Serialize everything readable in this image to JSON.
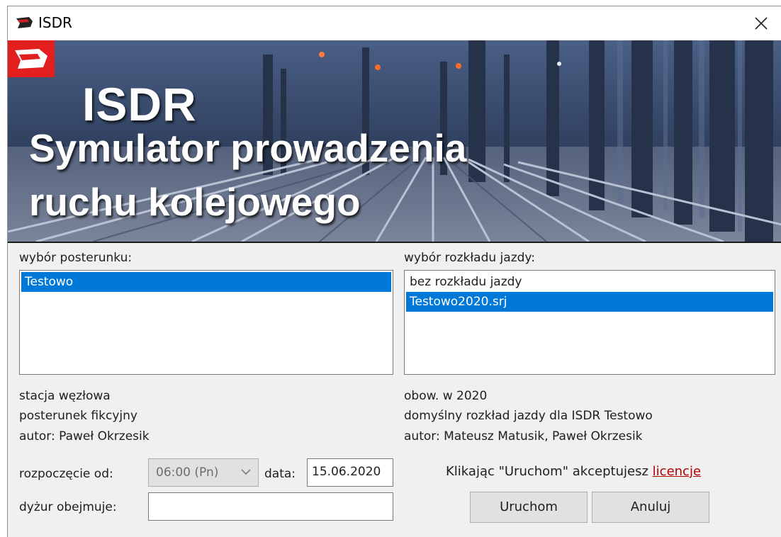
{
  "window": {
    "title": "ISDR"
  },
  "banner": {
    "title": "ISDR",
    "subtitle_line1": "Symulator prowadzenia",
    "subtitle_line2": "ruchu kolejowego"
  },
  "posterunek": {
    "label": "wybór posterunku:",
    "items": [
      "Testowo"
    ],
    "selected_index": 0,
    "info": [
      "stacja węzłowa",
      "posterunek fikcyjny",
      "autor: Paweł Okrzesik"
    ]
  },
  "rozklad": {
    "label": "wybór rozkładu jazdy:",
    "items": [
      "bez rozkładu jazdy",
      "Testowo2020.srj"
    ],
    "selected_index": 1,
    "info": [
      "obow. w 2020",
      "domyślny rozkład jazdy dla ISDR Testowo",
      "autor: Mateusz Matusik, Paweł Okrzesik"
    ]
  },
  "start": {
    "label": "rozpoczęcie od:",
    "value": "06:00 (Pn)",
    "date_label": "data:",
    "date_value": "15.06.2020"
  },
  "duty": {
    "label": "dyżur obejmuje:",
    "value": ""
  },
  "license": {
    "text": "Klikając \"Uruchom\" akceptujesz",
    "link": "licencje"
  },
  "buttons": {
    "run": "Uruchom",
    "cancel": "Anuluj"
  },
  "colors": {
    "selection": "#0078d7",
    "link": "#b30000",
    "logo_red": "#e31e1e"
  },
  "icons": {
    "app": "train-icon",
    "close": "close-icon",
    "dropdown": "chevron-down-icon"
  }
}
